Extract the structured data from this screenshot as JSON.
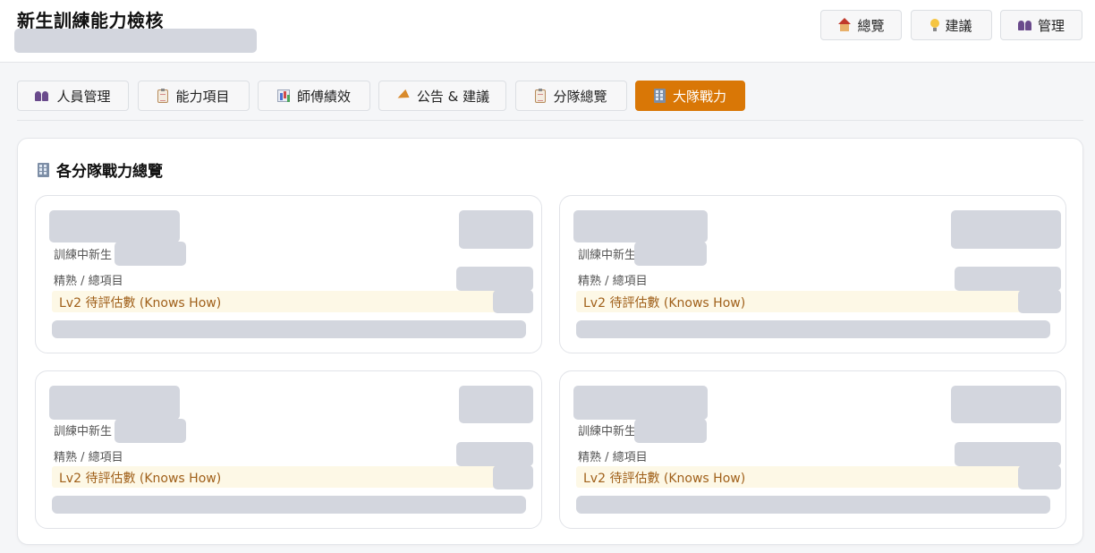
{
  "app": {
    "title": "新生訓練能力檢核"
  },
  "topnav": [
    {
      "label": "總覽",
      "icon": "house-icon"
    },
    {
      "label": "建議",
      "icon": "lightbulb-icon"
    },
    {
      "label": "管理",
      "icon": "people-icon"
    }
  ],
  "tabs": [
    {
      "label": "人員管理",
      "icon": "people-icon",
      "active": false
    },
    {
      "label": "能力項目",
      "icon": "clipboard-icon",
      "active": false
    },
    {
      "label": "師傅績效",
      "icon": "bar-chart-icon",
      "active": false
    },
    {
      "label": "公告 & 建議",
      "icon": "megaphone-icon",
      "active": false
    },
    {
      "label": "分隊總覽",
      "icon": "clipboard-icon",
      "active": false
    },
    {
      "label": "大隊戰力",
      "icon": "office-building-icon",
      "active": true
    }
  ],
  "panel": {
    "title": "各分隊戰力總覽",
    "icon": "office-building-icon"
  },
  "cards": [
    {
      "trainees_label": "訓練中新生",
      "mastery_label": "精熟 / 總項目",
      "lv2_label": "Lv2 待評估數 (Knows How)"
    },
    {
      "trainees_label": "訓練中新生",
      "mastery_label": "精熟 / 總項目",
      "lv2_label": "Lv2 待評估數 (Knows How)"
    },
    {
      "trainees_label": "訓練中新生",
      "mastery_label": "精熟 / 總項目",
      "lv2_label": "Lv2 待評估數 (Knows How)"
    },
    {
      "trainees_label": "訓練中新生",
      "mastery_label": "精熟 / 總項目",
      "lv2_label": "Lv2 待評估數 (Knows How)"
    }
  ],
  "colors": {
    "accent": "#d97706",
    "lv2_text": "#a0601a",
    "lv2_bg": "#fdf8e6",
    "redacted": "#d3d6de"
  }
}
